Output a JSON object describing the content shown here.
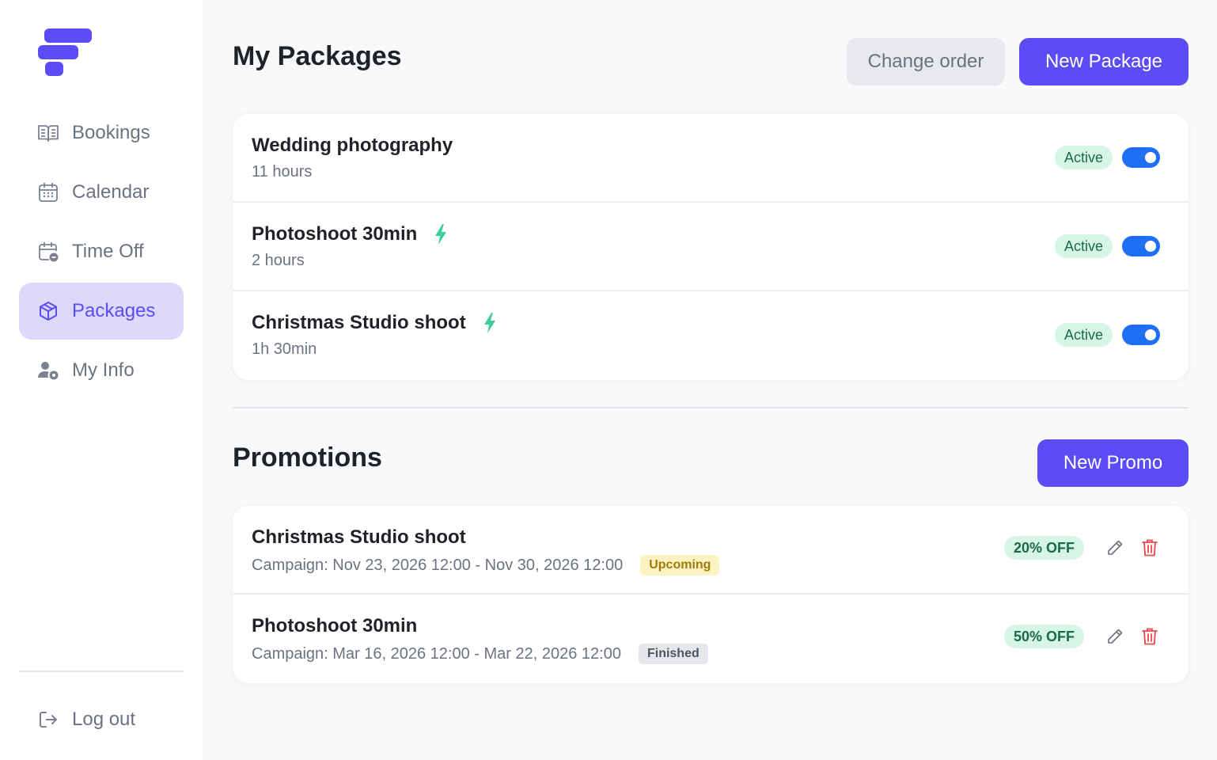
{
  "sidebar": {
    "items": [
      {
        "label": "Bookings",
        "icon": "book-icon"
      },
      {
        "label": "Calendar",
        "icon": "calendar-icon"
      },
      {
        "label": "Time Off",
        "icon": "time-off-icon"
      },
      {
        "label": "Packages",
        "icon": "package-icon",
        "active": true
      },
      {
        "label": "My Info",
        "icon": "user-settings-icon"
      }
    ],
    "logout_label": "Log out"
  },
  "packages": {
    "title": "My Packages",
    "change_order_label": "Change order",
    "new_package_label": "New Package",
    "items": [
      {
        "name": "Wedding photography",
        "duration": "11 hours",
        "status": "Active",
        "enabled": true,
        "instant": false
      },
      {
        "name": "Photoshoot 30min",
        "duration": "2 hours",
        "status": "Active",
        "enabled": true,
        "instant": true
      },
      {
        "name": "Christmas Studio shoot",
        "duration": "1h 30min",
        "status": "Active",
        "enabled": true,
        "instant": true
      }
    ]
  },
  "promotions": {
    "title": "Promotions",
    "new_promo_label": "New Promo",
    "items": [
      {
        "name": "Christmas Studio shoot",
        "campaign": "Campaign: Nov 23, 2026 12:00 - Nov 30, 2026 12:00",
        "status": "Upcoming",
        "discount": "20% OFF"
      },
      {
        "name": "Photoshoot 30min",
        "campaign": "Campaign: Mar 16, 2026 12:00 - Mar 22, 2026 12:00",
        "status": "Finished",
        "discount": "50% OFF"
      }
    ]
  },
  "colors": {
    "brand": "#5b4cf5",
    "toggle_on": "#1f6ff5",
    "active_badge_bg": "#d6f5e6",
    "upcoming_badge_bg": "#fdf2c2",
    "finished_badge_bg": "#e6e7ea",
    "bolt": "#3ecf9a",
    "delete": "#e5484d"
  }
}
